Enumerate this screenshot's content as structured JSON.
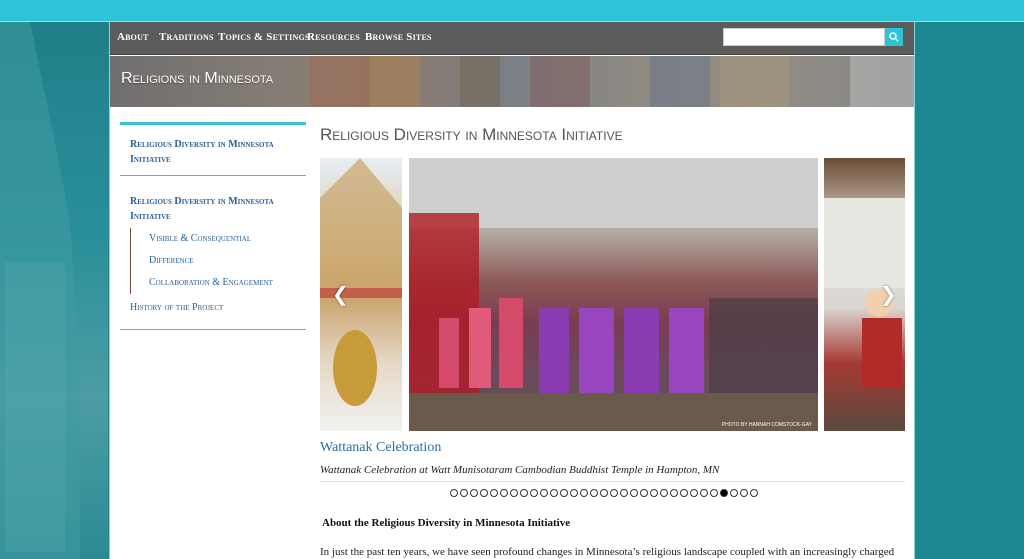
{
  "nav": {
    "items": [
      "About",
      "Traditions",
      "Topics & Settings",
      "Resources",
      "Browse Sites"
    ],
    "search_placeholder": "",
    "search_icon": "search-icon"
  },
  "banner": {
    "title": "Religions in Minnesota"
  },
  "sidebar": {
    "group1": [
      {
        "label": "Religious Diversity in Minnesota Initiative"
      }
    ],
    "group2": {
      "main": "Religious Diversity in Minnesota Initiative",
      "sub": [
        "Visible & Consequential Difference",
        "Collaboration & Engagement"
      ],
      "history": "History of the Project"
    }
  },
  "main": {
    "title": "Religious Diversity in Minnesota Initiative",
    "slideshow": {
      "photo_credit": "PHOTO BY HANNAH COMSTOCK-GAY",
      "prev_icon": "chevron-left-icon",
      "next_icon": "chevron-right-icon",
      "caption_title": "Wattanak Celebration",
      "caption_text": "Wattanak Celebration at Watt Munisotaram Cambodian Buddhist Temple in Hampton, MN",
      "dot_count": 31,
      "active_dot": 27
    },
    "about_heading": "About the Religious Diversity in Minnesota Initiative",
    "intro": "In just the past ten years, we have seen profound changes in Minnesota’s religious landscape coupled with an increasingly charged"
  },
  "colors": {
    "accent": "#2ec3d6",
    "link": "#2a5f95",
    "background": "#1d8791",
    "navbar": "#5b5b5b"
  }
}
